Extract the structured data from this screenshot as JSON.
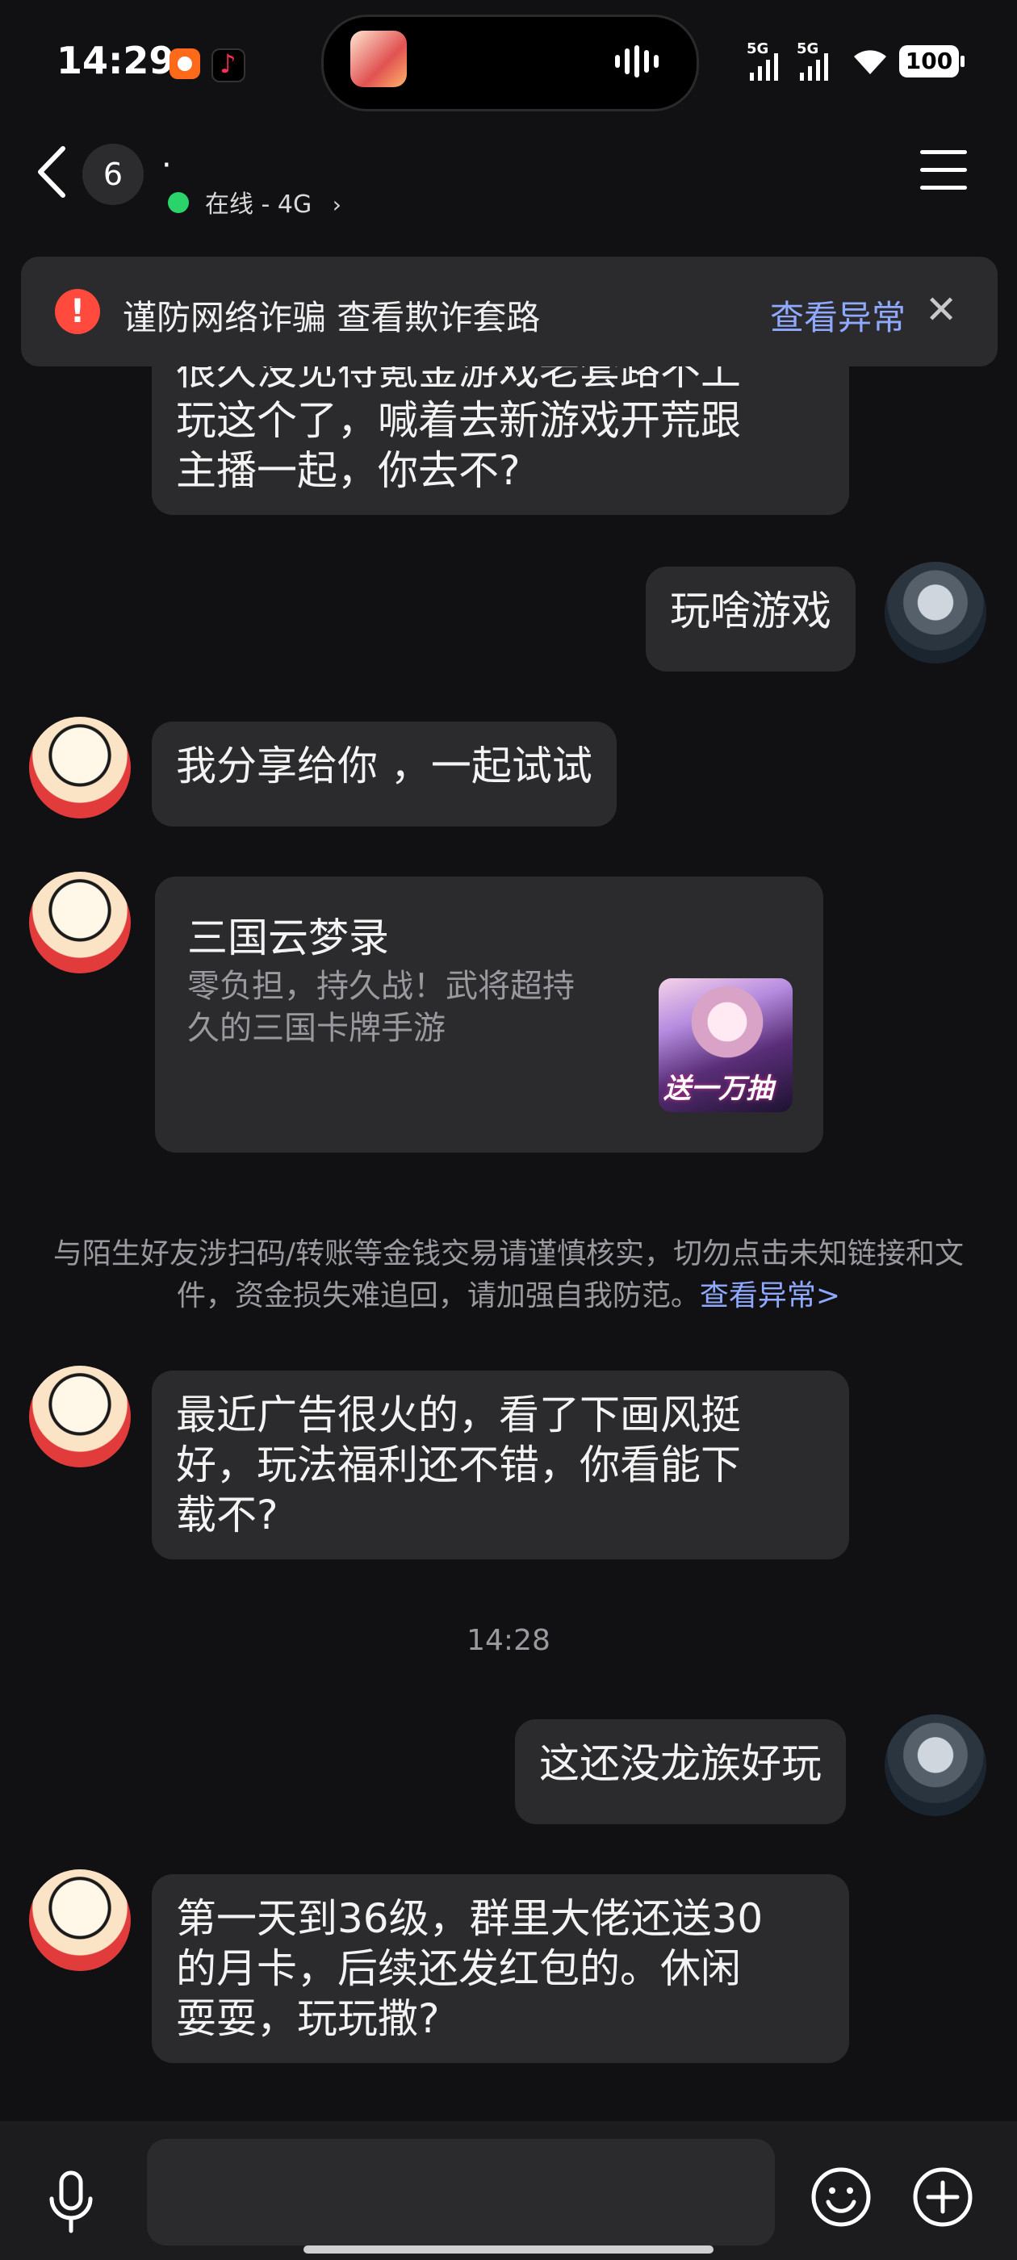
{
  "status_bar": {
    "time": "14:29",
    "signal_labels": [
      "5G",
      "5G"
    ],
    "battery": "100",
    "icons": [
      "notification-app-icon",
      "tiktok-icon",
      "signal-icon",
      "wifi-icon",
      "battery-icon"
    ]
  },
  "header": {
    "unread_count": "6",
    "contact_name": "·",
    "online_status": "在线 - 4G"
  },
  "fraud_banner": {
    "text": "谨防网络诈骗 查看欺诈套路",
    "link": "查看异常",
    "close": "✕"
  },
  "messages": [
    {
      "side": "left",
      "lines": [
        "很久没见待氪金游戏老套路不上",
        "玩这个了，喊着去新游戏开荒跟",
        "主播一起，你去不?"
      ]
    },
    {
      "side": "right",
      "lines": [
        "玩啥游戏"
      ]
    },
    {
      "side": "left",
      "lines": [
        "我分享给你 ，一起试试"
      ]
    },
    {
      "side": "left",
      "type": "card",
      "title": "三国云梦录",
      "desc_lines": [
        "零负担，持久战！武将超持",
        "久的三国卡牌手游"
      ],
      "thumb_label": "送一万抽"
    },
    {
      "type": "system",
      "text": "与陌生好友涉扫码/转账等金钱交易请谨慎核实，切勿点击未知链接和文件，资金损失难追回，请加强自我防范。",
      "link": "查看异常>"
    },
    {
      "side": "left",
      "lines": [
        "最近广告很火的，看了下画风挺",
        "好，玩法福利还不错，你看能下",
        "载不?"
      ]
    },
    {
      "type": "timestamp",
      "text": "14:28"
    },
    {
      "side": "right",
      "lines": [
        "这还没龙族好玩"
      ]
    },
    {
      "side": "left",
      "lines": [
        "第一天到36级，群里大佬还送30",
        "的月卡，后续还发红包的。休闲",
        "耍耍，玩玩撒?"
      ]
    }
  ],
  "input": {
    "value": "",
    "placeholder": ""
  }
}
